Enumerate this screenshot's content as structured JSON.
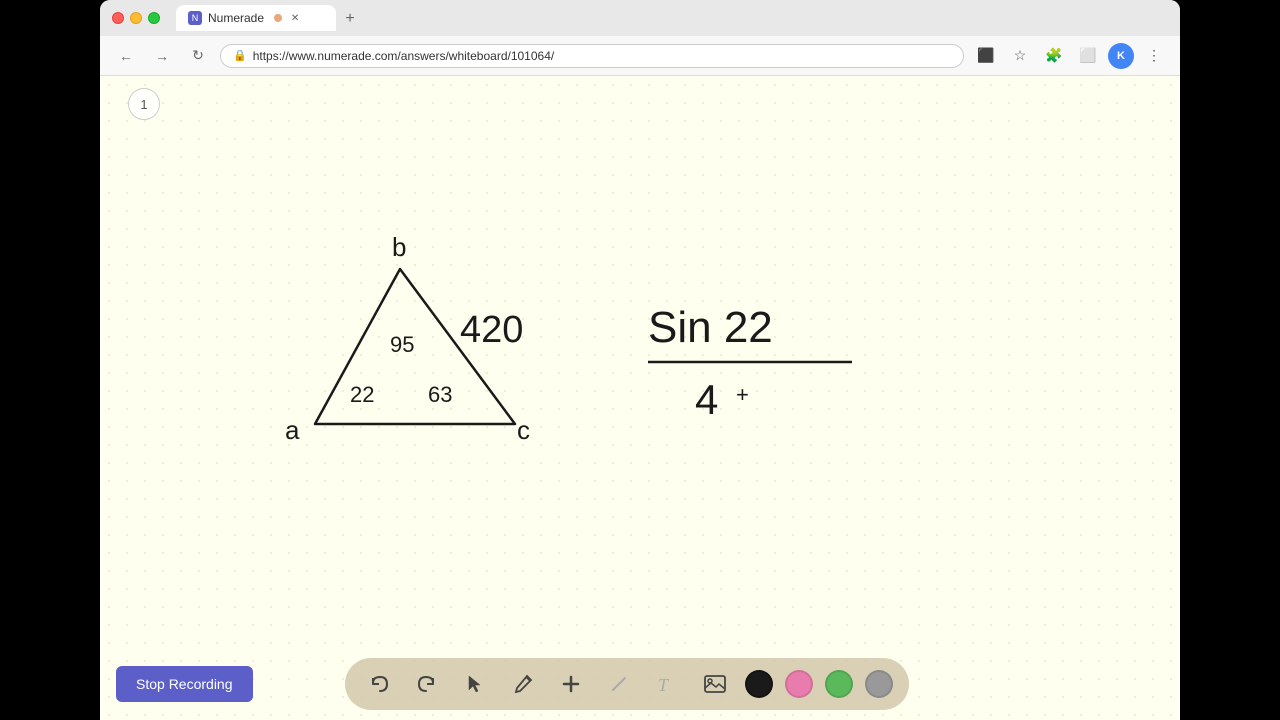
{
  "browser": {
    "tab_label": "Numerade",
    "tab_favicon": "N",
    "url": "https://www.numerade.com/answers/whiteboard/101064/",
    "profile_initial": "K",
    "new_tab_symbol": "+"
  },
  "toolbar": {
    "stop_recording_label": "Stop Recording",
    "page_number": "1"
  },
  "tools": {
    "undo_label": "↩",
    "redo_label": "↪",
    "select_label": "↖",
    "pencil_label": "✏",
    "add_label": "+",
    "eraser_label": "/",
    "text_label": "T",
    "image_label": "🖼"
  },
  "colors": {
    "black": "#1a1a1a",
    "pink": "#e87cad",
    "green": "#5bb85b",
    "gray": "#999999",
    "accent_purple": "#5b5fc7",
    "bg_yellow": "#fffff0",
    "toolbar_bg": "rgba(210,200,170,0.85)"
  }
}
